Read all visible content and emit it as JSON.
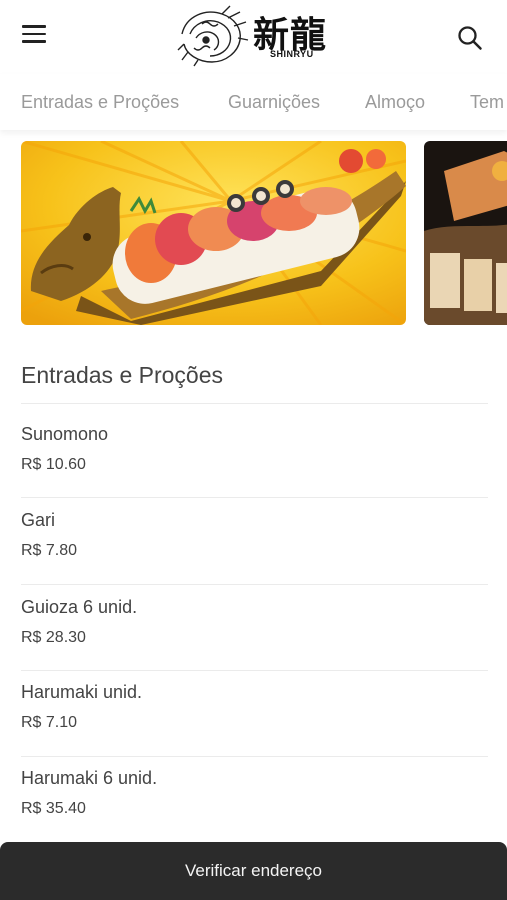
{
  "header": {
    "logo_text": "新龍",
    "logo_subtitle": "SHINRYU",
    "menu_icon": "hamburger-menu-icon",
    "search_icon": "search-icon"
  },
  "tabs": [
    "Entradas e Proções",
    "Guarnições",
    "Almoço",
    "Tem"
  ],
  "section": {
    "title": "Entradas e Proções",
    "items": [
      {
        "name": "Sunomono",
        "price": "R$ 10.60"
      },
      {
        "name": "Gari",
        "price": "R$ 7.80"
      },
      {
        "name": "Guioza 6 unid.",
        "price": "R$ 28.30"
      },
      {
        "name": "Harumaki unid.",
        "price": "R$ 7.10"
      },
      {
        "name": "Harumaki 6 unid.",
        "price": "R$ 35.40"
      }
    ]
  },
  "bottom_bar": {
    "label": "Verificar endereço"
  },
  "colors": {
    "bottom_bar": "#2b2b2b",
    "tab_text": "#9a9a9a",
    "banner_yellow": "#f7c21a"
  }
}
